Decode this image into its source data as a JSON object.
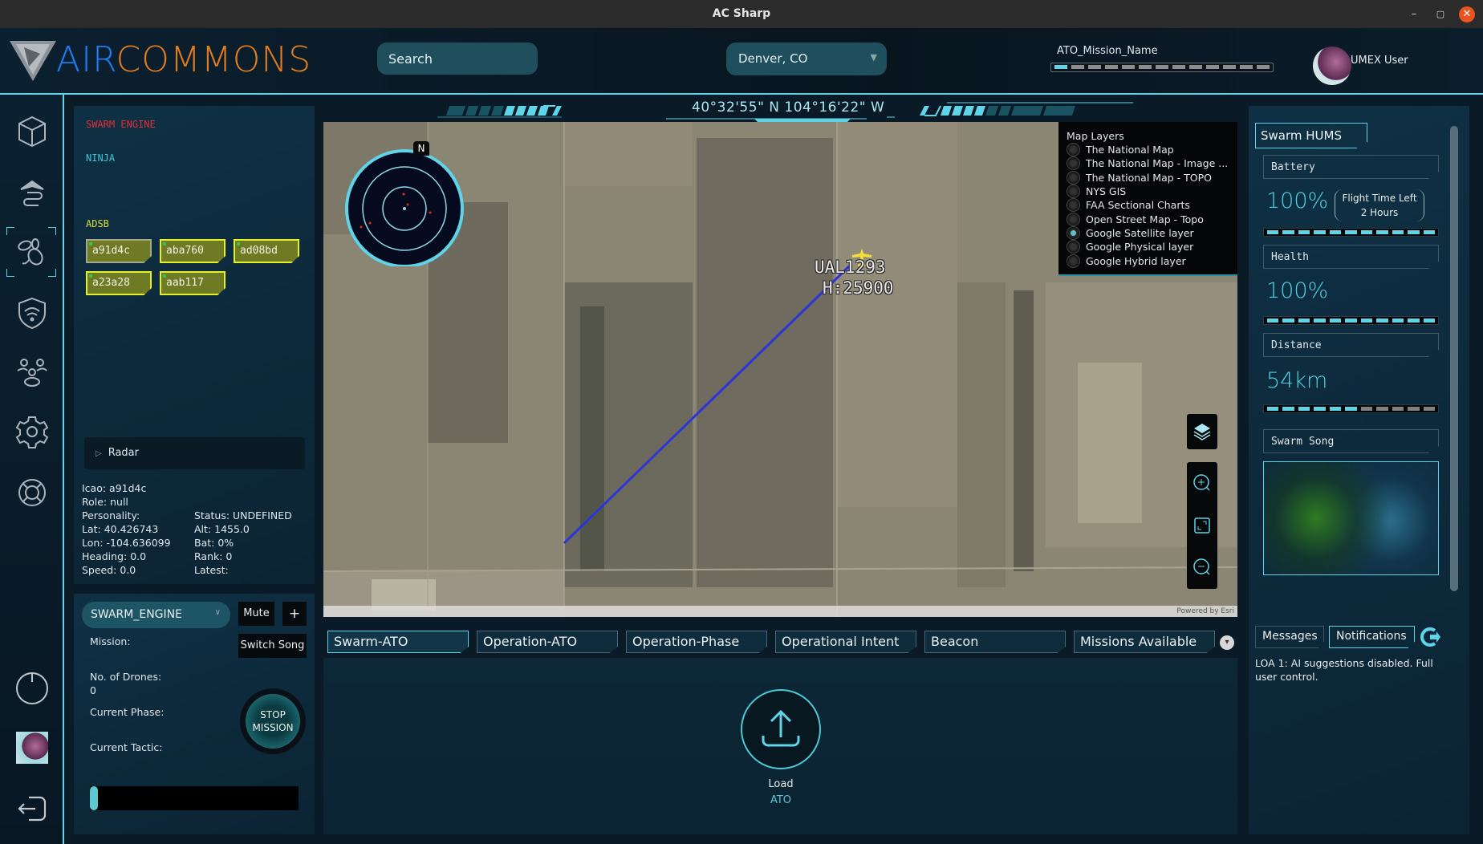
{
  "window": {
    "title": "AC Sharp",
    "minimize": "–",
    "maximize": "▢",
    "close": "✕"
  },
  "header": {
    "logo_air": "AIR",
    "logo_commons": "COMMONS",
    "search_placeholder": "Search",
    "location": "Denver, CO",
    "ato_mission_name": "ATO_Mission_Name",
    "ato_progress_percent": 3,
    "user_name": "UMEX User"
  },
  "rail": {
    "items": [
      "cube-icon",
      "aircraft-route-icon",
      "swarm-bee-icon",
      "shield-wifi-icon",
      "group-icon",
      "settings-icon",
      "lifebuoy-icon"
    ],
    "selected": "swarm-bee-icon",
    "bottom": [
      "power-icon",
      "user-avatar",
      "logout-icon"
    ]
  },
  "left_panel": {
    "swarm_engine_label": "SWARM ENGINE",
    "ninja_label": "NINJA",
    "adsb_label": "ADSB",
    "adsb_chips": [
      "a91d4c",
      "aba760",
      "ad08bd",
      "a23a28",
      "aab117"
    ],
    "adsb_selected": "a91d4c",
    "radar_label": "Radar",
    "details": {
      "icao": "Icao: a91d4c",
      "role": "Role: null",
      "personality": "Personality:",
      "status": "Status: UNDEFINED",
      "lat": "Lat: 40.426743",
      "alt": "Alt: 1455.0",
      "lon": "Lon: -104.636099",
      "bat": "Bat: 0%",
      "heading": "Heading: 0.0",
      "rank": "Rank: 0",
      "speed": "Speed: 0.0",
      "latest": "Latest:"
    }
  },
  "swarm_control": {
    "engine_select": "SWARM_ENGINE",
    "mute": "Mute",
    "add": "+",
    "switch_song": "Switch Song",
    "mission_label": "Mission:",
    "drones_label": "No. of Drones:",
    "drones_value": "0",
    "phase_label": "Current Phase:",
    "tactic_label": "Current Tactic:",
    "stop_line1": "STOP",
    "stop_line2": "MISSION",
    "slider_value": 0
  },
  "map": {
    "coordinates": "40°32'55\" N  104°16'22\" W",
    "north": "N",
    "flight_callsign": "UAL1293",
    "flight_altitude": "H:25900",
    "attribution": "Powered by Esri",
    "layers_title": "Map Layers",
    "layers": [
      "The National Map",
      "The National Map - Image ...",
      "The National Map - TOPO",
      "NYS GIS",
      "FAA Sectional Charts",
      "Open Street Map - Topo",
      "Google Satellite layer",
      "Google Physical layer",
      "Google Hybrid layer"
    ],
    "selected_layer": "Google Satellite layer",
    "controls": [
      "layers-icon",
      "zoom-in-icon",
      "fullscreen-icon",
      "zoom-out-icon"
    ]
  },
  "tabs": {
    "items": [
      "Swarm-ATO",
      "Operation-ATO",
      "Operation-Phase",
      "Operational Intent",
      "Beacon",
      "Missions Available"
    ],
    "active": "Swarm-ATO",
    "more": "▾"
  },
  "ato": {
    "load_label": "Load",
    "load_sub": "ATO"
  },
  "hums": {
    "title": "Swarm HUMS",
    "battery_label": "Battery",
    "battery_value": "100%",
    "battery_percent": 100,
    "flight_time_label": "Flight Time Left",
    "flight_time_value": "2 Hours",
    "health_label": "Health",
    "health_value": "100%",
    "health_percent": 100,
    "distance_label": "Distance",
    "distance_value": "54km",
    "distance_percent": 55,
    "song_label": "Swarm Song"
  },
  "notifications": {
    "messages_tab": "Messages",
    "notifications_tab": "Notifications",
    "active": "Notifications",
    "text": "LOA 1: AI suggestions disabled. Full user control."
  },
  "colors": {
    "accent": "#5fd4e8",
    "logo_air": "#1f7bf0",
    "logo_commons": "#e07b1e",
    "swarm_engine": "#e0303a",
    "ninja": "#3fc7d6",
    "adsb": "#d6e03a",
    "flight_path": "#2b35d8",
    "aircraft": "#f2e036"
  }
}
